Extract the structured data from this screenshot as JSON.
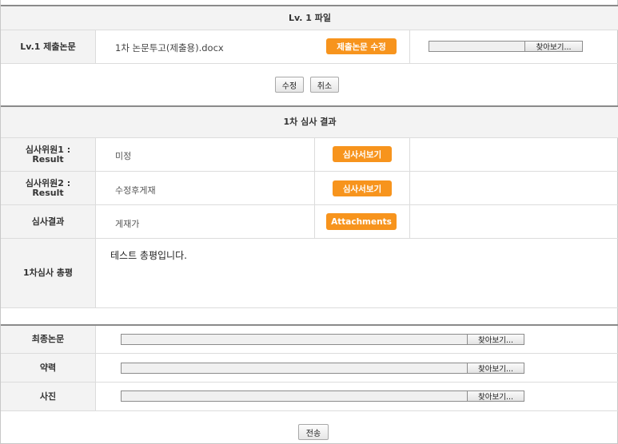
{
  "file_section": {
    "title": "Lv. 1 파일",
    "row_label": "Lv.1 제출논문",
    "filename": "1차 논문투고(제출용).docx",
    "edit_button": "제출논문 수정",
    "browse_label": "찾아보기...",
    "save_button": "수정",
    "cancel_button": "취소"
  },
  "review_section": {
    "title": "1차 심사 결과",
    "rows": [
      {
        "label_line1": "심사위원1 :",
        "label_line2": "Result",
        "value": "미정",
        "button": "심사서보기"
      },
      {
        "label_line1": "심사위원2 :",
        "label_line2": "Result",
        "value": "수정후게재",
        "button": "심사서보기"
      },
      {
        "label_line1": "심사결과",
        "label_line2": "",
        "value": "게재가",
        "button": "Attachments"
      }
    ],
    "comment_label": "1차심사 총평",
    "comment_text": "테스트 총평입니다."
  },
  "final_section": {
    "rows": [
      {
        "label": "최종논문",
        "browse_label": "찾아보기..."
      },
      {
        "label": "약력",
        "browse_label": "찾아보기..."
      },
      {
        "label": "사진",
        "browse_label": "찾아보기..."
      }
    ],
    "submit_button": "전송"
  },
  "colors": {
    "accent": "#f7941d",
    "label_bg": "#f3f3f3",
    "border": "#dcdcdc"
  }
}
